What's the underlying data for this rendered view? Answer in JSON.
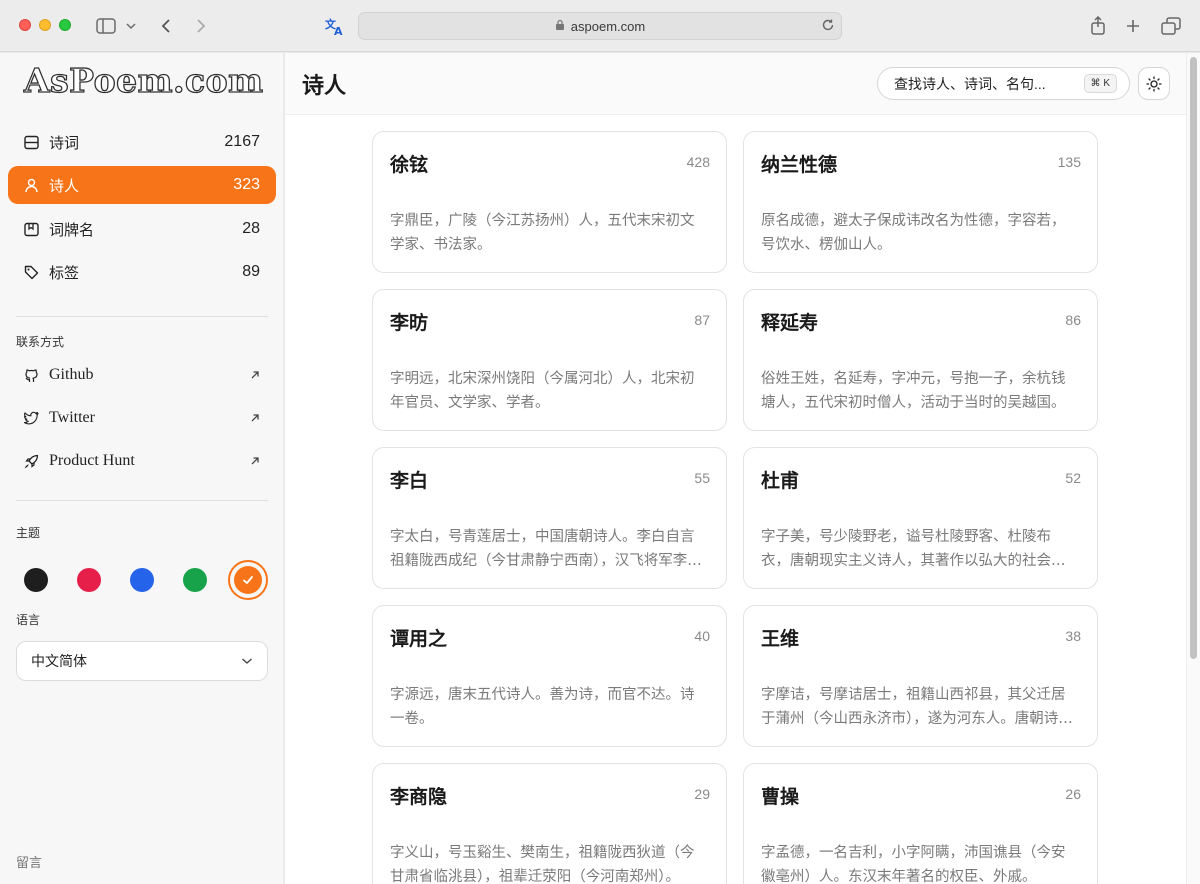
{
  "browser": {
    "url": "aspoem.com"
  },
  "sidebar": {
    "logo": "AsPoem.com",
    "nav": [
      {
        "label": "诗词",
        "count": "2167",
        "icon": "poem-icon"
      },
      {
        "label": "诗人",
        "count": "323",
        "icon": "person-icon"
      },
      {
        "label": "词牌名",
        "count": "28",
        "icon": "bookmark-icon"
      },
      {
        "label": "标签",
        "count": "89",
        "icon": "tag-icon"
      }
    ],
    "contact_label": "联系方式",
    "links": [
      {
        "label": "Github",
        "icon": "github-icon"
      },
      {
        "label": "Twitter",
        "icon": "twitter-icon"
      },
      {
        "label": "Product Hunt",
        "icon": "rocket-icon"
      }
    ],
    "theme_label": "主题",
    "theme_colors": [
      "#1e1e1e",
      "#e51f4a",
      "#2563eb",
      "#16a34a",
      "#f77418"
    ],
    "language_label": "语言",
    "language_value": "中文简体",
    "footer_link": "留言"
  },
  "header": {
    "title": "诗人",
    "search_placeholder": "查找诗人、诗词、名句...",
    "search_shortcut": "⌘ K"
  },
  "poets": [
    {
      "name": "徐铉",
      "count": "428",
      "desc": "字鼎臣，广陵（今江苏扬州）人，五代末宋初文学家、书法家。"
    },
    {
      "name": "纳兰性德",
      "count": "135",
      "desc": "原名成德，避太子保成讳改名为性德，字容若，号饮水、楞伽山人。"
    },
    {
      "name": "李昉",
      "count": "87",
      "desc": "字明远，北宋深州饶阳（今属河北）人，北宋初年官员、文学家、学者。"
    },
    {
      "name": "释延寿",
      "count": "86",
      "desc": "俗姓王姓，名延寿，字冲元，号抱一子，余杭钱塘人，五代宋初时僧人，活动于当时的吴越国。"
    },
    {
      "name": "李白",
      "count": "55",
      "desc": "字太白，号青莲居士，中国唐朝诗人。李白自言祖籍陇西成纪（今甘肃静宁西南），汉飞将军李广后裔。"
    },
    {
      "name": "杜甫",
      "count": "52",
      "desc": "字子美，号少陵野老，谥号杜陵野客、杜陵布衣，唐朝现实主义诗人，其著作以弘大的社会写实著称。"
    },
    {
      "name": "谭用之",
      "count": "40",
      "desc": "字源远，唐末五代诗人。善为诗，而官不达。诗一卷。"
    },
    {
      "name": "王维",
      "count": "38",
      "desc": "字摩诘，号摩诘居士，祖籍山西祁县，其父迁居于蒲州（今山西永济市），遂为河东人。唐朝诗人。"
    },
    {
      "name": "李商隐",
      "count": "29",
      "desc": "字义山，号玉谿生、樊南生，祖籍陇西狄道（今甘肃省临洮县），祖辈迁荥阳（今河南郑州）。"
    },
    {
      "name": "曹操",
      "count": "26",
      "desc": "字孟德，一名吉利，小字阿瞒，沛国谯县（今安徽亳州）人。东汉末年著名的权臣、外戚。"
    }
  ]
}
